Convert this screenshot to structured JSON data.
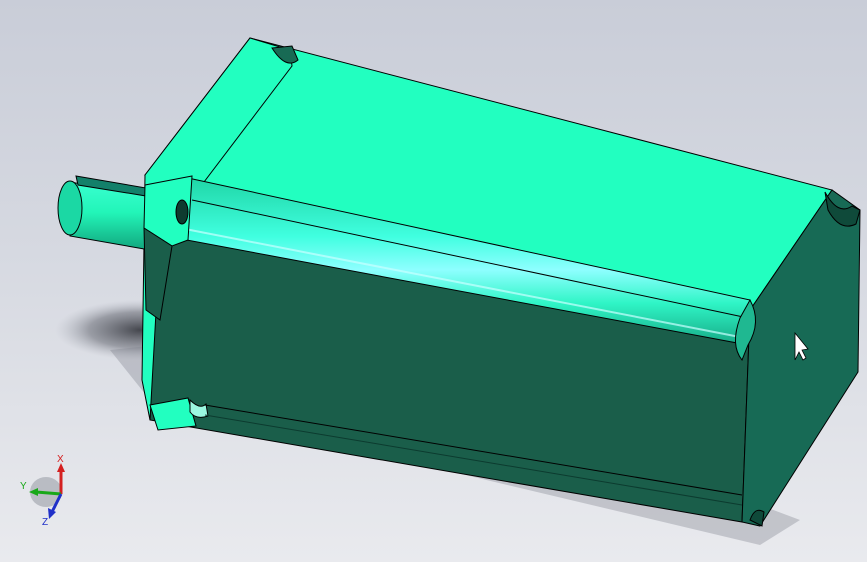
{
  "viewport": {
    "background_top": "#c9cdd8",
    "background_bottom": "#e9eaee"
  },
  "model": {
    "face_top_color": "#22ffc0",
    "face_front_color": "#1a5e4a",
    "face_end_color": "#186a54",
    "edge_color": "#000000"
  },
  "triad": {
    "x_label": "X",
    "y_label": "Y",
    "z_label": "Z",
    "x_color": "#d42020",
    "y_color": "#18a818",
    "z_color": "#2030c8"
  }
}
